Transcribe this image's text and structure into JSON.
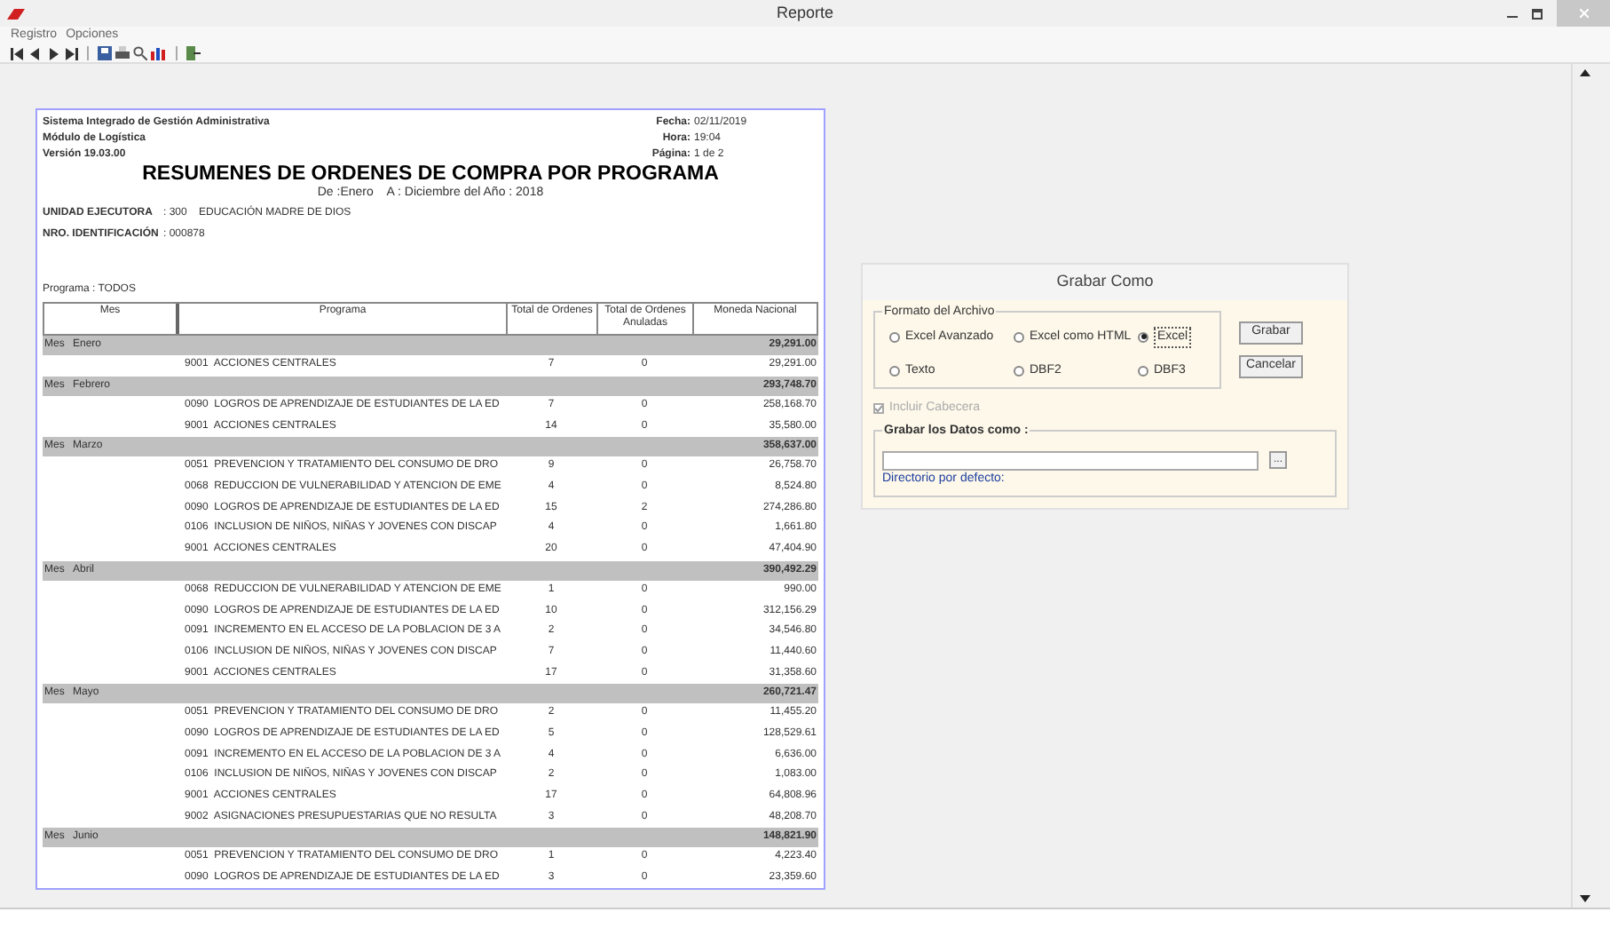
{
  "window": {
    "title": "Reporte"
  },
  "menu": [
    "Registro",
    "Opciones"
  ],
  "report": {
    "system": "Sistema Integrado de Gestión Administrativa",
    "module": "Módulo de Logística",
    "version": "Versión 19.03.00",
    "meta": [
      {
        "label": "Fecha:",
        "value": "02/11/2019"
      },
      {
        "label": "Hora:",
        "value": "19:04"
      },
      {
        "label": "Página:",
        "value": "1 de 2"
      }
    ],
    "title": "RESUMENES DE ORDENES DE COMPRA POR PROGRAMA",
    "subtitle": "De :Enero    A : Diciembre del Año : 2018",
    "fields": [
      {
        "label": "UNIDAD EJECUTORA",
        "value": ": 300    EDUCACIÓN MADRE DE DIOS"
      },
      {
        "label": "NRO. IDENTIFICACIÓN",
        "value": ": 000878"
      }
    ],
    "programa": "Programa : TODOS",
    "columns": [
      "Mes",
      "Programa",
      "Total de Ordenes",
      "Total de Ordenes Anuladas",
      "Moneda Nacional"
    ],
    "groups": [
      {
        "prefix": "Mes",
        "month": "Enero",
        "total": "29,291.00",
        "rows": [
          {
            "program": "9001  ACCIONES CENTRALES",
            "orders": "7",
            "cancelled": "0",
            "amount": "29,291.00"
          }
        ]
      },
      {
        "prefix": "Mes",
        "month": "Febrero",
        "total": "293,748.70",
        "rows": [
          {
            "program": "0090  LOGROS DE APRENDIZAJE DE ESTUDIANTES DE LA ED",
            "orders": "7",
            "cancelled": "0",
            "amount": "258,168.70"
          },
          {
            "program": "9001  ACCIONES CENTRALES",
            "orders": "14",
            "cancelled": "0",
            "amount": "35,580.00"
          }
        ]
      },
      {
        "prefix": "Mes",
        "month": "Marzo",
        "total": "358,637.00",
        "rows": [
          {
            "program": "0051  PREVENCION Y TRATAMIENTO DEL CONSUMO DE DRO",
            "orders": "9",
            "cancelled": "0",
            "amount": "26,758.70"
          },
          {
            "program": "0068  REDUCCION DE VULNERABILIDAD Y ATENCION DE EME",
            "orders": "4",
            "cancelled": "0",
            "amount": "8,524.80"
          },
          {
            "program": "0090  LOGROS DE APRENDIZAJE DE ESTUDIANTES DE LA ED",
            "orders": "15",
            "cancelled": "2",
            "amount": "274,286.80"
          },
          {
            "program": "0106  INCLUSION DE NIÑOS, NIÑAS Y JOVENES CON DISCAP",
            "orders": "4",
            "cancelled": "0",
            "amount": "1,661.80"
          },
          {
            "program": "9001  ACCIONES CENTRALES",
            "orders": "20",
            "cancelled": "0",
            "amount": "47,404.90"
          }
        ]
      },
      {
        "prefix": "Mes",
        "month": "Abril",
        "total": "390,492.29",
        "rows": [
          {
            "program": "0068  REDUCCION DE VULNERABILIDAD Y ATENCION DE EME",
            "orders": "1",
            "cancelled": "0",
            "amount": "990.00"
          },
          {
            "program": "0090  LOGROS DE APRENDIZAJE DE ESTUDIANTES DE LA ED",
            "orders": "10",
            "cancelled": "0",
            "amount": "312,156.29"
          },
          {
            "program": "0091  INCREMENTO EN EL ACCESO DE LA POBLACION DE 3 A",
            "orders": "2",
            "cancelled": "0",
            "amount": "34,546.80"
          },
          {
            "program": "0106  INCLUSION DE NIÑOS, NIÑAS Y JOVENES CON DISCAP",
            "orders": "7",
            "cancelled": "0",
            "amount": "11,440.60"
          },
          {
            "program": "9001  ACCIONES CENTRALES",
            "orders": "17",
            "cancelled": "0",
            "amount": "31,358.60"
          }
        ]
      },
      {
        "prefix": "Mes",
        "month": "Mayo",
        "total": "260,721.47",
        "rows": [
          {
            "program": "0051  PREVENCION Y TRATAMIENTO DEL CONSUMO DE DRO",
            "orders": "2",
            "cancelled": "0",
            "amount": "11,455.20"
          },
          {
            "program": "0090  LOGROS DE APRENDIZAJE DE ESTUDIANTES DE LA ED",
            "orders": "5",
            "cancelled": "0",
            "amount": "128,529.61"
          },
          {
            "program": "0091  INCREMENTO EN EL ACCESO DE LA POBLACION DE 3 A",
            "orders": "4",
            "cancelled": "0",
            "amount": "6,636.00"
          },
          {
            "program": "0106  INCLUSION DE NIÑOS, NIÑAS Y JOVENES CON DISCAP",
            "orders": "2",
            "cancelled": "0",
            "amount": "1,083.00"
          },
          {
            "program": "9001  ACCIONES CENTRALES",
            "orders": "17",
            "cancelled": "0",
            "amount": "64,808.96"
          },
          {
            "program": "9002  ASIGNACIONES PRESUPUESTARIAS QUE NO RESULTA",
            "orders": "3",
            "cancelled": "0",
            "amount": "48,208.70"
          }
        ]
      },
      {
        "prefix": "Mes",
        "month": "Junio",
        "total": "148,821.90",
        "rows": [
          {
            "program": "0051  PREVENCION Y TRATAMIENTO DEL CONSUMO DE DRO",
            "orders": "1",
            "cancelled": "0",
            "amount": "4,223.40"
          },
          {
            "program": "0090  LOGROS DE APRENDIZAJE DE ESTUDIANTES DE LA ED",
            "orders": "3",
            "cancelled": "0",
            "amount": "23,359.60"
          }
        ]
      }
    ]
  },
  "dialog": {
    "title": "Grabar Como",
    "format_group": "Formato del Archivo",
    "formats": [
      {
        "label": "Excel Avanzado",
        "selected": false
      },
      {
        "label": "Excel como HTML",
        "selected": false
      },
      {
        "label": "Excel",
        "selected": true
      },
      {
        "label": "Texto",
        "selected": false
      },
      {
        "label": "DBF2",
        "selected": false
      },
      {
        "label": "DBF3",
        "selected": false
      }
    ],
    "buttons": [
      "Grabar",
      "Cancelar"
    ],
    "include_header": {
      "label": "Incluir Cabecera",
      "checked": true,
      "disabled": true
    },
    "save_group": "Grabar los Datos como :",
    "browse": "...",
    "default_dir": "Directorio por defecto:"
  }
}
